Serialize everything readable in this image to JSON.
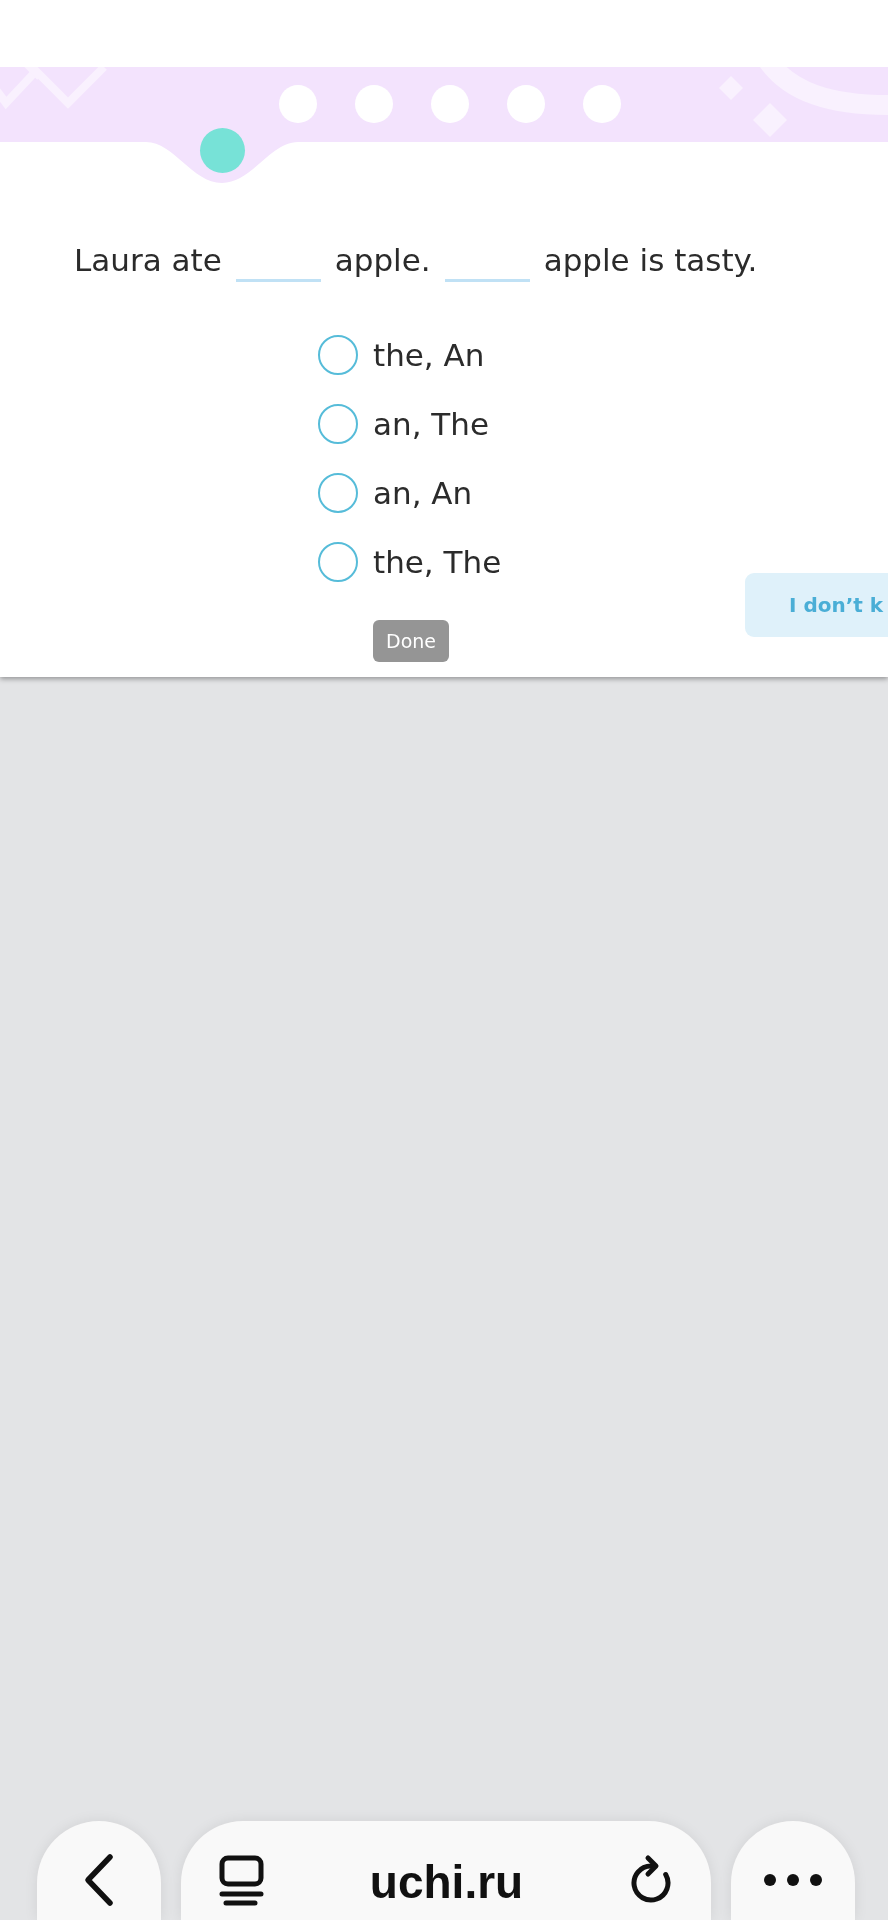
{
  "progress": {
    "steps": [
      {
        "current": true
      },
      {
        "current": false
      },
      {
        "current": false
      },
      {
        "current": false
      },
      {
        "current": false
      },
      {
        "current": false
      }
    ]
  },
  "question": {
    "parts": [
      {
        "kind": "text",
        "text": "Laura ate"
      },
      {
        "kind": "blank"
      },
      {
        "kind": "text",
        "text": "apple."
      },
      {
        "kind": "blank"
      },
      {
        "kind": "text",
        "text": "apple is tasty."
      }
    ]
  },
  "options": [
    {
      "label": "the, An",
      "selected": false
    },
    {
      "label": "an, The",
      "selected": false
    },
    {
      "label": "an, An",
      "selected": false
    },
    {
      "label": "the, The",
      "selected": false
    }
  ],
  "done_button": {
    "label": "Done",
    "disabled": true
  },
  "dont_know_button": {
    "label": "I don’t k"
  },
  "browser_bar": {
    "url": "uchi.ru"
  }
}
